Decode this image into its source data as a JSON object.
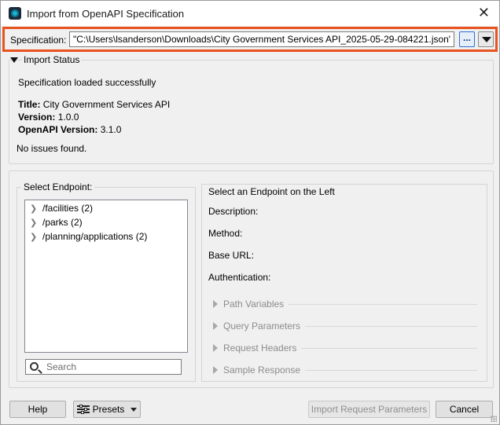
{
  "window": {
    "title": "Import from OpenAPI Specification",
    "close_glyph": "✕"
  },
  "spec": {
    "label": "Specification:",
    "value": "\"C:\\Users\\lsanderson\\Downloads\\City Government Services API_2025-05-29-084221.json\"",
    "browse_label": "..."
  },
  "status": {
    "header": "Import Status",
    "message": "Specification loaded successfully",
    "title_label": "Title:",
    "title_value": "City Government Services API",
    "version_label": "Version:",
    "version_value": "1.0.0",
    "openapi_label": "OpenAPI Version:",
    "openapi_value": "3.1.0",
    "issues": "No issues found."
  },
  "endpoints": {
    "group_label": "Select Endpoint:",
    "items": [
      {
        "label": "/facilities (2)"
      },
      {
        "label": "/parks (2)"
      },
      {
        "label": "/planning/applications (2)"
      }
    ],
    "search_placeholder": "Search"
  },
  "details": {
    "title": "Select an Endpoint on the Left",
    "description_label": "Description:",
    "method_label": "Method:",
    "base_url_label": "Base URL:",
    "auth_label": "Authentication:",
    "sections": [
      "Path Variables",
      "Query Parameters",
      "Request Headers",
      "Sample Response"
    ]
  },
  "footer": {
    "help": "Help",
    "presets": "Presets",
    "import": "Import Request Parameters",
    "cancel": "Cancel"
  },
  "colors": {
    "accent_border": "#e8531f",
    "browse_border": "#2d6fd6"
  },
  "icons": [
    "app-icon",
    "close-icon",
    "browse-icon",
    "dropdown-icon",
    "collapse-triangle-icon",
    "chevron-right-icon",
    "search-icon",
    "expand-triangle-icon",
    "presets-icon",
    "chevron-down-icon"
  ]
}
